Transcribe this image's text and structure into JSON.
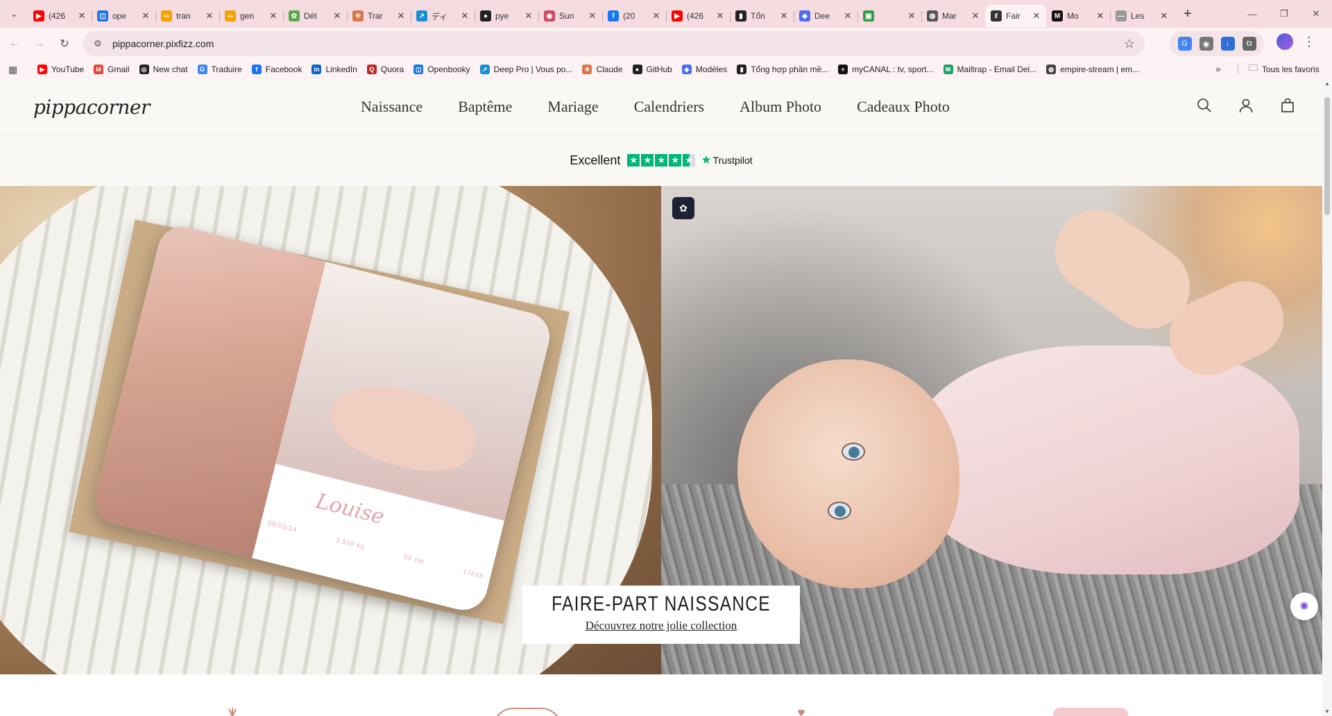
{
  "browser": {
    "tabs": [
      {
        "title": "(426",
        "color": "#ff0000",
        "glyph": "▶"
      },
      {
        "title": "ope",
        "color": "#1a73e8",
        "glyph": "◫"
      },
      {
        "title": "tran",
        "color": "#f4a300",
        "glyph": "∞"
      },
      {
        "title": "gen",
        "color": "#f4a300",
        "glyph": "∞"
      },
      {
        "title": "Dét",
        "color": "#5ba84c",
        "glyph": "✿"
      },
      {
        "title": "Trar",
        "color": "#d9774b",
        "glyph": "✳"
      },
      {
        "title": "ディ",
        "color": "#1a8fd6",
        "glyph": "↗"
      },
      {
        "title": "pye",
        "color": "#222222",
        "glyph": "●"
      },
      {
        "title": "Sun",
        "color": "#d04a5c",
        "glyph": "◉"
      },
      {
        "title": "(20",
        "color": "#1877f2",
        "glyph": "f"
      },
      {
        "title": "(426",
        "color": "#ff0000",
        "glyph": "▶"
      },
      {
        "title": "Tổn",
        "color": "#222222",
        "glyph": "▮"
      },
      {
        "title": "Dee",
        "color": "#4a6cf7",
        "glyph": "◆"
      },
      {
        "title": "",
        "color": "#2ea043",
        "glyph": "▣"
      },
      {
        "title": "Mar",
        "color": "#555555",
        "glyph": "◍"
      },
      {
        "title": "Fair",
        "color": "#333333",
        "glyph": "ℓ",
        "active": true
      },
      {
        "title": "Mo",
        "color": "#111111",
        "glyph": "M"
      },
      {
        "title": "Les",
        "color": "#999999",
        "glyph": "—"
      }
    ],
    "url": "pippacorner.pixfizz.com",
    "bookmarks": [
      {
        "label": "YouTube",
        "color": "#ff0000",
        "glyph": "▶"
      },
      {
        "label": "Gmail",
        "color": "#ea4335",
        "glyph": "M"
      },
      {
        "label": "New chat",
        "color": "#222222",
        "glyph": "◎"
      },
      {
        "label": "Traduire",
        "color": "#4285f4",
        "glyph": "G"
      },
      {
        "label": "Facebook",
        "color": "#1877f2",
        "glyph": "f"
      },
      {
        "label": "LinkedIn",
        "color": "#0a66c2",
        "glyph": "in"
      },
      {
        "label": "Quora",
        "color": "#b92b27",
        "glyph": "Q"
      },
      {
        "label": "Openbooky",
        "color": "#1a73e8",
        "glyph": "◫"
      },
      {
        "label": "Deep Pro | Vous po...",
        "color": "#1a8fd6",
        "glyph": "↗"
      },
      {
        "label": "Claude",
        "color": "#d9774b",
        "glyph": "✳"
      },
      {
        "label": "GitHub",
        "color": "#222222",
        "glyph": "●"
      },
      {
        "label": "Modèles",
        "color": "#4a6cf7",
        "glyph": "◆"
      },
      {
        "label": "Tổng hợp phần mề...",
        "color": "#222222",
        "glyph": "▮"
      },
      {
        "label": "myCANAL : tv, sport...",
        "color": "#111111",
        "glyph": "+"
      },
      {
        "label": "Mailtrap - Email Del...",
        "color": "#22a06b",
        "glyph": "✉"
      },
      {
        "label": "empire-stream | em...",
        "color": "#444444",
        "glyph": "◍"
      }
    ],
    "all_bookmarks": "Tous les favoris"
  },
  "site": {
    "logo": "pippacorner",
    "nav": [
      "Naissance",
      "Baptême",
      "Mariage",
      "Calendriers",
      "Album Photo",
      "Cadeaux Photo"
    ],
    "trustpilot": {
      "rating_word": "Excellent",
      "brand": "Trustpilot",
      "stars": 4.5
    },
    "hero": {
      "card_name": "Louise",
      "card_stats": [
        "08/03/24",
        "3,520 kg",
        "53 cm",
        "17h15"
      ],
      "cta_title": "FAIRE-PART NAISSANCE",
      "cta_link": "Découvrez notre jolie collection"
    }
  },
  "colors": {
    "accent_green": "#00b67a",
    "chrome_pink": "#f6dbe0",
    "card_pink": "#e6a2ad"
  }
}
